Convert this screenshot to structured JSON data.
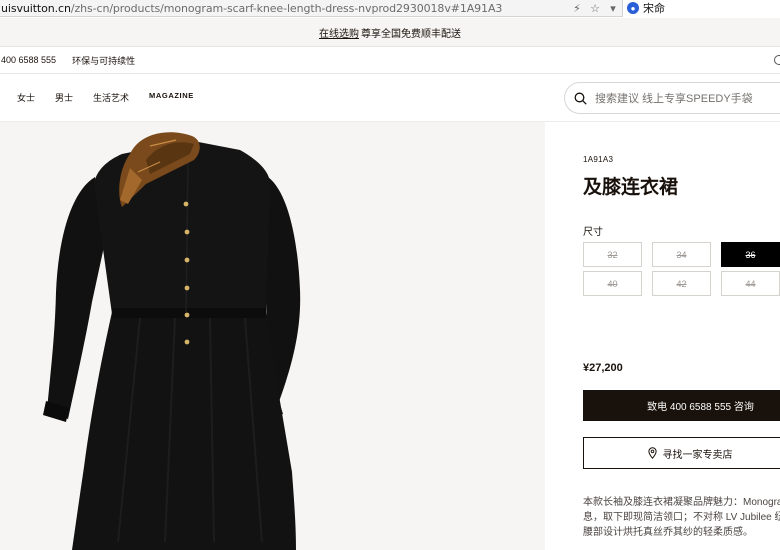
{
  "browser": {
    "url_host": "uisvuitton.cn",
    "url_path": "/zhs-cn/products/monogram-scarf-knee-length-dress-nvprod2930018v#1A91A3",
    "search_engine_label": "宋命"
  },
  "promo": {
    "link": "在线选购",
    "text": "尊享全国免费顺丰配送"
  },
  "utility": {
    "phone": "400 6588 555",
    "sustainability": "环保与可持续性"
  },
  "nav": {
    "items": [
      "女士",
      "男士",
      "生活艺术",
      "MAGAZINE"
    ],
    "search_placeholder": "搜索建议  线上专享SPEEDY手袋"
  },
  "product": {
    "sku": "1A91A3",
    "title": "及膝连衣裙",
    "size_label": "尺寸",
    "sizes": [
      {
        "label": "32",
        "available": false
      },
      {
        "label": "34",
        "available": false
      },
      {
        "label": "36",
        "selected": true
      },
      {
        "label": "40",
        "available": false
      },
      {
        "label": "42",
        "available": false
      },
      {
        "label": "44",
        "available": false
      }
    ],
    "price": "¥27,200",
    "call_button": "致电 400 6588 555 咨询",
    "store_button": "寻找一家专卖店",
    "description_lines": [
      "本款长袖及膝连衣裙凝聚品牌魅力：Monogram",
      "息，取下即现简洁领口；不对称 LV Jubilee 纽",
      "腰部设计烘托真丝乔其纱的轻柔质感。"
    ]
  },
  "colors": {
    "brand_dark": "#19110b",
    "image_bg": "#f6f5f3",
    "dress": "#121212",
    "scarf": "#7a4a1c",
    "buttons_gold": "#d6b46a"
  }
}
